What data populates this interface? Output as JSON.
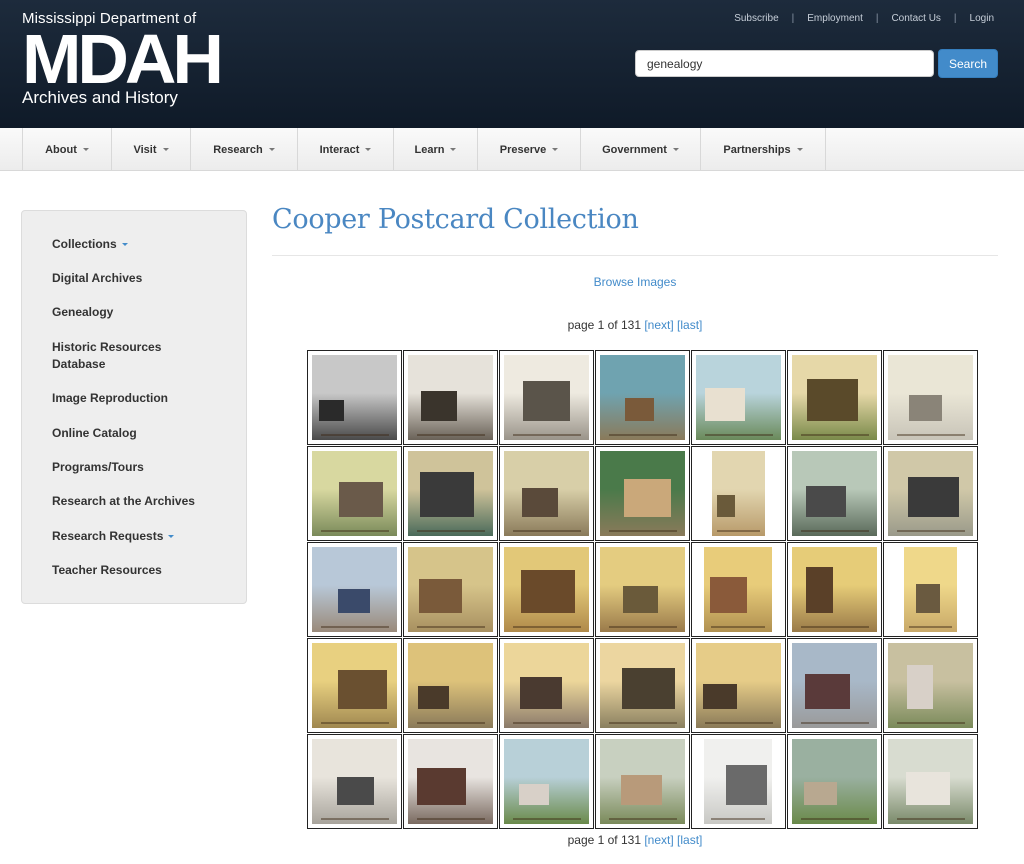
{
  "header": {
    "logo_top": "Mississippi Department of",
    "logo_big": "MDAH",
    "logo_bottom": "Archives and History",
    "util_links": [
      "Subscribe",
      "Employment",
      "Contact Us",
      "Login"
    ],
    "search_value": "genealogy",
    "search_button": "Search"
  },
  "nav": {
    "items": [
      "About",
      "Visit",
      "Research",
      "Interact",
      "Learn",
      "Preserve",
      "Government",
      "Partnerships"
    ]
  },
  "sidebar": {
    "items": [
      {
        "label": "Collections",
        "dropdown": true
      },
      {
        "label": "Digital Archives",
        "dropdown": false
      },
      {
        "label": "Genealogy",
        "dropdown": false
      },
      {
        "label": "Historic Resources Database",
        "dropdown": false
      },
      {
        "label": "Image Reproduction",
        "dropdown": false
      },
      {
        "label": "Online Catalog",
        "dropdown": false
      },
      {
        "label": "Programs/Tours",
        "dropdown": false
      },
      {
        "label": "Research at the Archives",
        "dropdown": false
      },
      {
        "label": "Research Requests",
        "dropdown": true
      },
      {
        "label": "Teacher Resources",
        "dropdown": false
      }
    ]
  },
  "main": {
    "title": "Cooper Postcard Collection",
    "browse_link": "Browse Images",
    "pager": {
      "prefix": "page 1 of 131",
      "next": "[next]",
      "last": "[last]"
    }
  },
  "gallery": {
    "rows": 5,
    "cols": 7,
    "thumb_count": 35
  },
  "colors": {
    "header_bg": "#16243a",
    "link": "#428bca",
    "title": "#4a87c2",
    "sepia": "#d9c07a"
  }
}
